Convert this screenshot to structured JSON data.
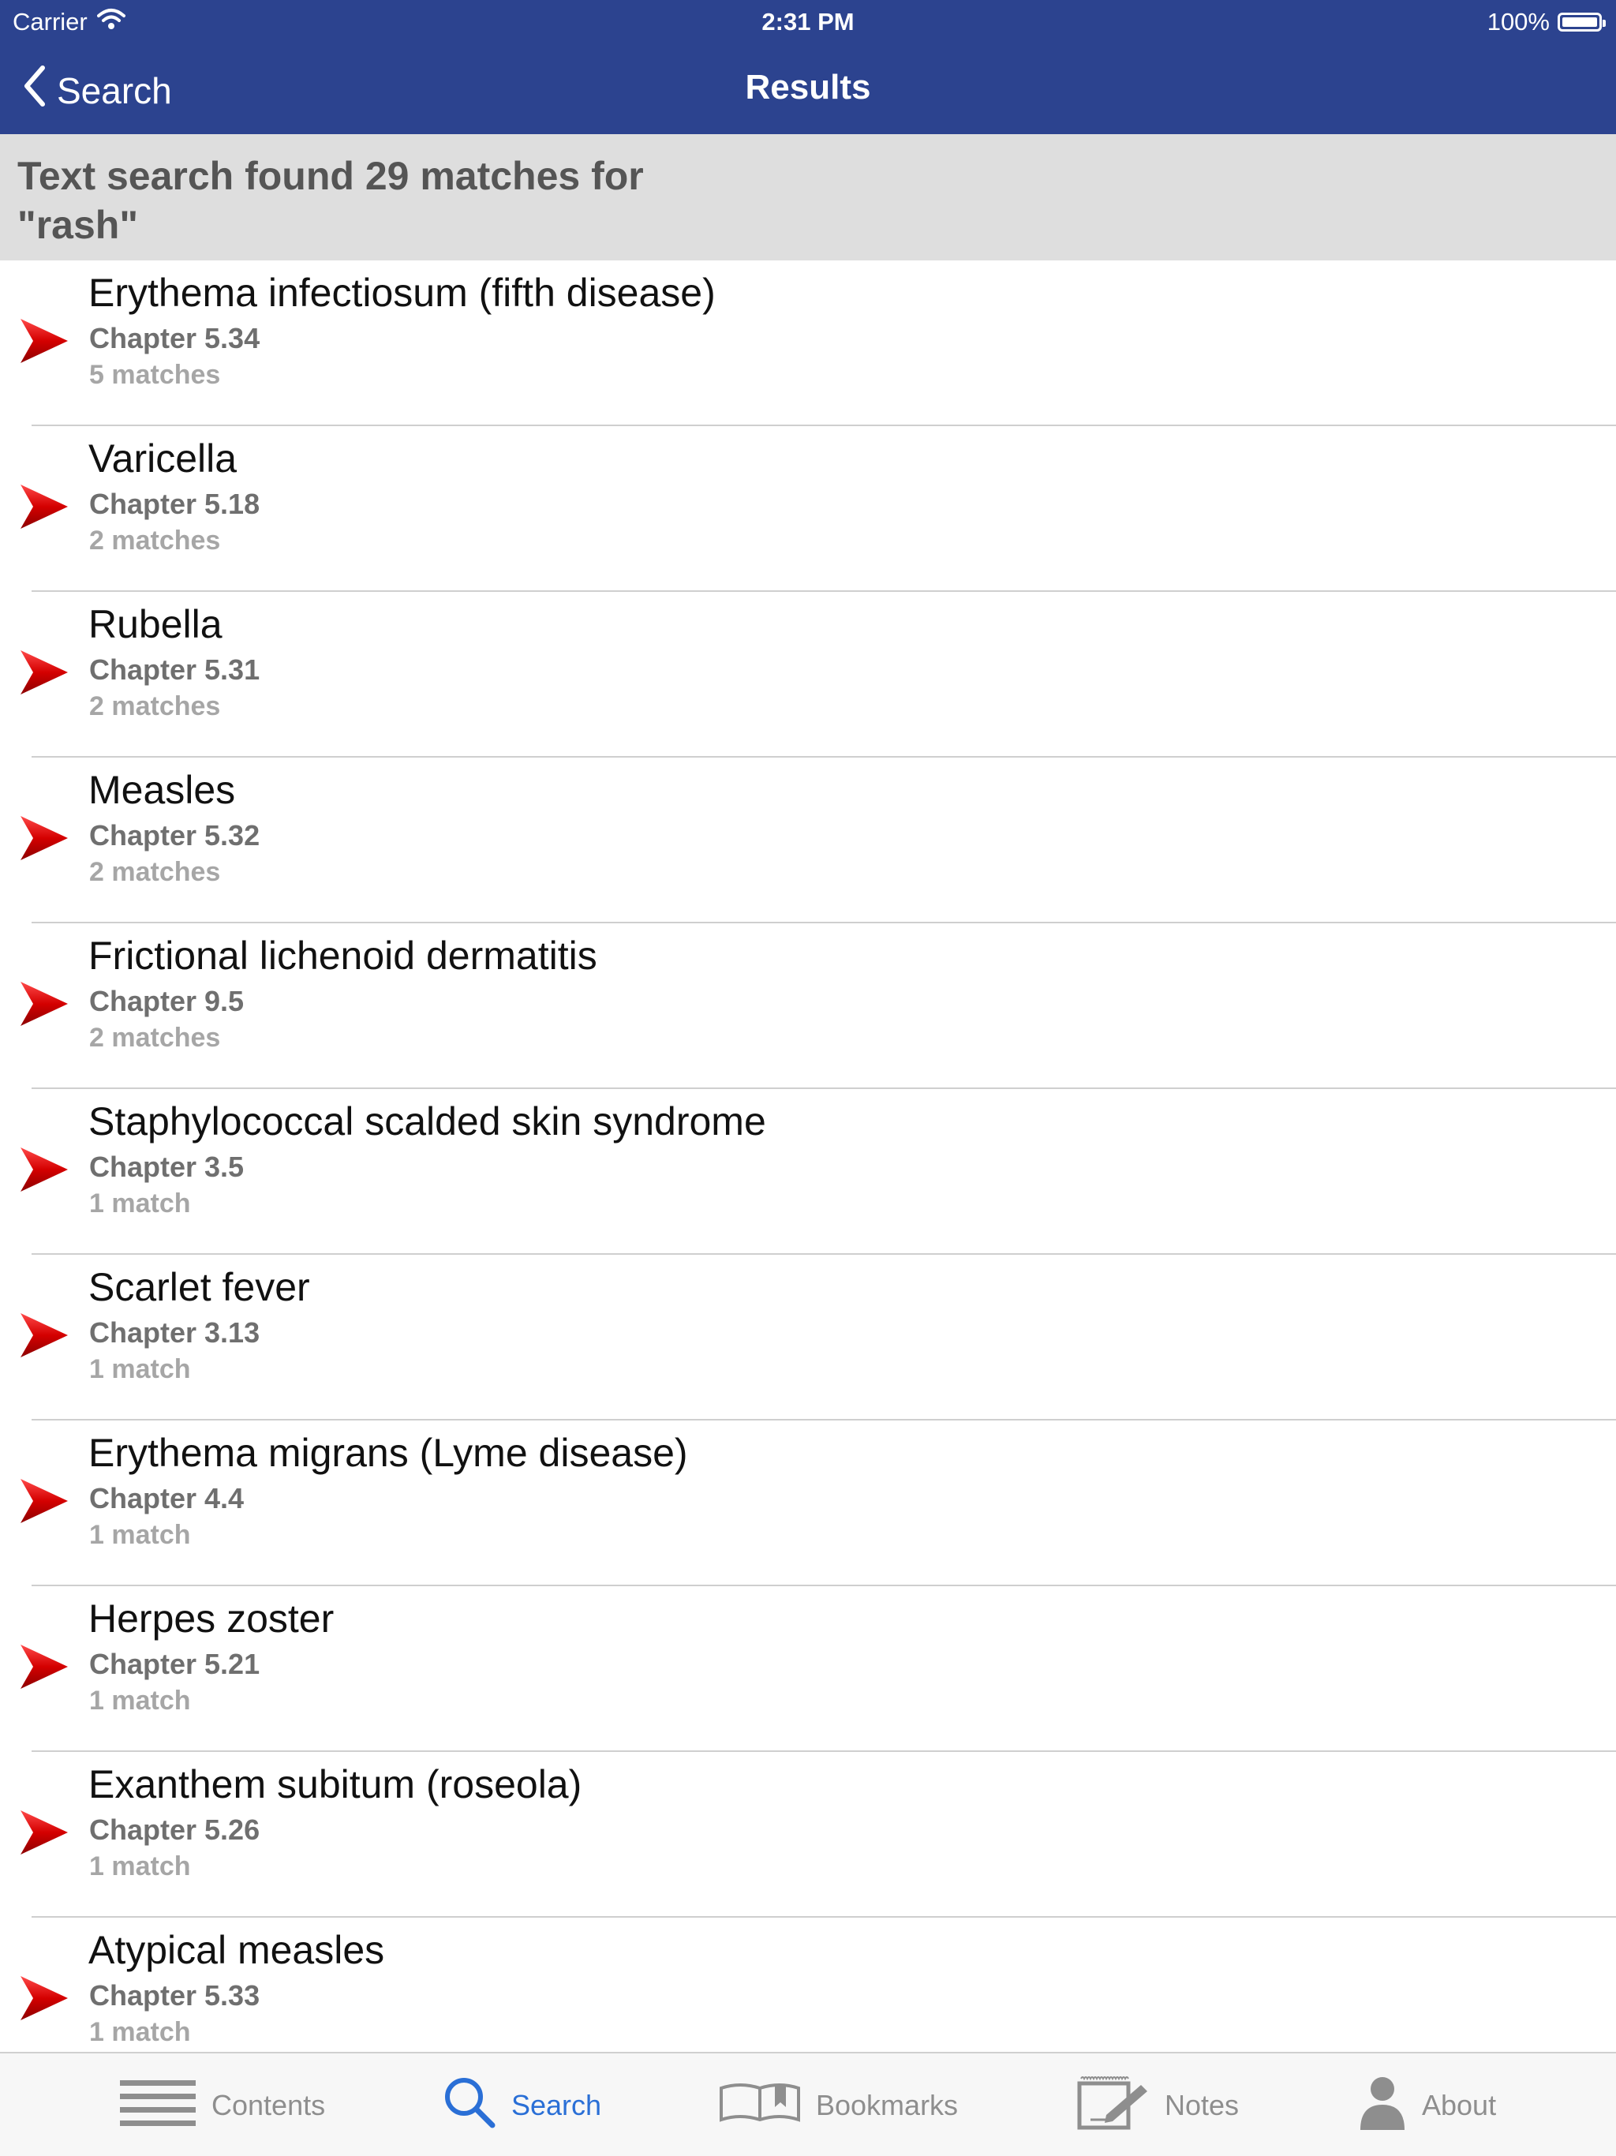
{
  "status_bar": {
    "carrier": "Carrier",
    "time": "2:31 PM",
    "battery": "100%"
  },
  "nav": {
    "back_label": "Search",
    "title": "Results"
  },
  "summary": {
    "line1": "Text search found 29 matches for",
    "line2": "\"rash\""
  },
  "results": [
    {
      "title": "Erythema infectiosum (fifth disease)",
      "chapter": "Chapter 5.34",
      "matches": "5 matches"
    },
    {
      "title": "Varicella",
      "chapter": "Chapter 5.18",
      "matches": "2 matches"
    },
    {
      "title": "Rubella",
      "chapter": "Chapter 5.31",
      "matches": "2 matches"
    },
    {
      "title": "Measles",
      "chapter": "Chapter 5.32",
      "matches": "2 matches"
    },
    {
      "title": "Frictional lichenoid dermatitis",
      "chapter": "Chapter 9.5",
      "matches": "2 matches"
    },
    {
      "title": "Staphylococcal scalded skin syndrome",
      "chapter": "Chapter 3.5",
      "matches": "1 match"
    },
    {
      "title": "Scarlet fever",
      "chapter": "Chapter 3.13",
      "matches": "1 match"
    },
    {
      "title": "Erythema migrans (Lyme disease)",
      "chapter": "Chapter 4.4",
      "matches": "1 match"
    },
    {
      "title": "Herpes zoster",
      "chapter": "Chapter 5.21",
      "matches": "1 match"
    },
    {
      "title": "Exanthem subitum (roseola)",
      "chapter": "Chapter 5.26",
      "matches": "1 match"
    },
    {
      "title": "Atypical measles",
      "chapter": "Chapter 5.33",
      "matches": "1 match"
    }
  ],
  "tabs": [
    {
      "label": "Contents",
      "icon": "list-icon"
    },
    {
      "label": "Search",
      "icon": "search-icon"
    },
    {
      "label": "Bookmarks",
      "icon": "book-icon"
    },
    {
      "label": "Notes",
      "icon": "notepad-icon"
    },
    {
      "label": "About",
      "icon": "person-icon"
    }
  ],
  "colors": {
    "nav_bar": "#2c438f",
    "summary_bg": "#dedede",
    "arrow": "#d40000",
    "tab_active": "#2a6fd6",
    "tab_inactive": "#8e8e8e"
  },
  "active_tab": "Search"
}
